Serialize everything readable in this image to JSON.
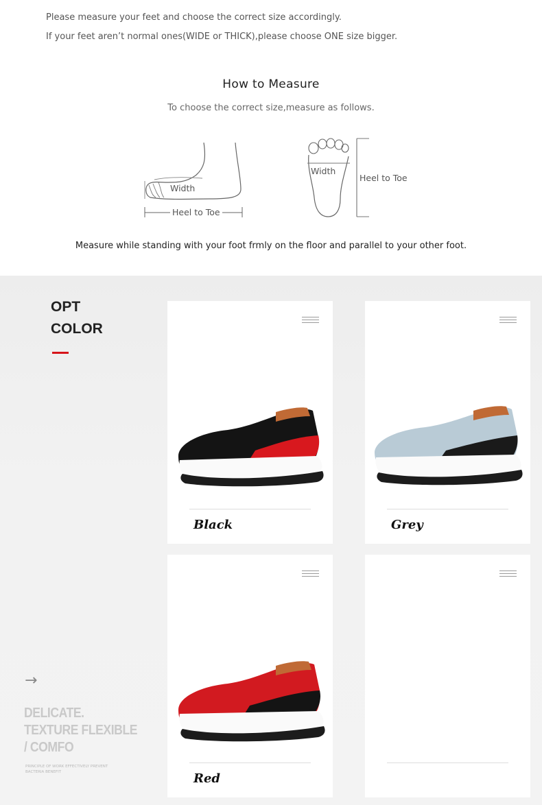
{
  "notes": {
    "line1": "Please measure your feet and choose the correct size accordingly.",
    "line2": "If your feet aren’t normal ones(WIDE or THICK),please choose ONE size bigger."
  },
  "measure": {
    "title": "How to Measure",
    "subtitle": "To choose the correct size,measure as follows.",
    "side_width_label": "Width",
    "side_length_label": "Heel to Toe",
    "top_width_label": "Width",
    "top_length_label": "Heel to Toe",
    "instruction": "Measure while standing with your foot frmly on the floor and parallel to your other foot."
  },
  "options": {
    "heading_line1": "OPT",
    "heading_line2": "COLOR",
    "accent_color": "#d6141a",
    "cards": [
      {
        "label": "Black",
        "shoe_upper": "#141414",
        "shoe_accent": "#d8181e"
      },
      {
        "label": "Grey",
        "shoe_upper": "#b9cbd6",
        "shoe_accent": "#1a1a1a"
      },
      {
        "label": "Red",
        "shoe_upper": "#d21a20",
        "shoe_accent": "#141414"
      },
      {
        "label": ""
      }
    ]
  },
  "promo": {
    "arrow_icon": "arrow-right-icon",
    "tagline_1": "DELICATE.",
    "tagline_2": "TEXTURE FLEXIBLE",
    "tagline_3": "/ COMFO",
    "fine_1": "PRINCIPLE OF WORK EFFECTIVELY PREVENT",
    "fine_2": "BACTERIA BENEFIT"
  }
}
